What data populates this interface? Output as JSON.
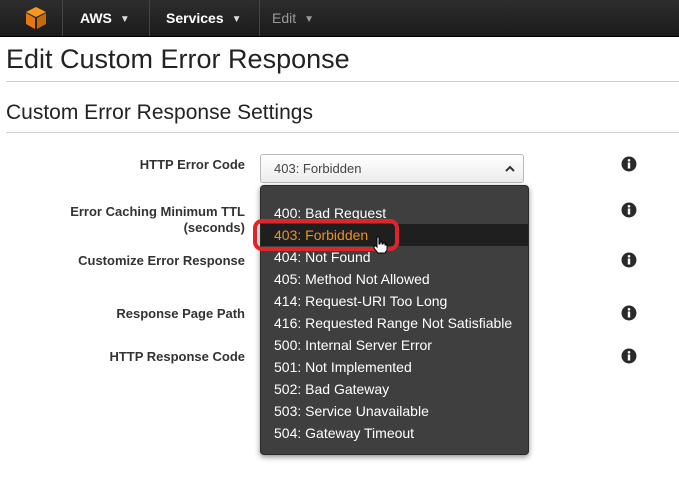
{
  "nav": {
    "logo_icon": "aws-cube-logo",
    "aws_label": "AWS",
    "services_label": "Services",
    "edit_label": "Edit",
    "caret": "▼"
  },
  "page": {
    "title": "Edit Custom Error Response",
    "section_title": "Custom Error Response Settings"
  },
  "form": {
    "http_error_code_label": "HTTP Error Code",
    "ttl_label_line1": "Error Caching Minimum TTL",
    "ttl_label_line2": "(seconds)",
    "customize_label": "Customize Error Response",
    "response_path_label": "Response Page Path",
    "response_code_label": "HTTP Response Code",
    "selected_value": "403: Forbidden",
    "info_icon": "info-icon"
  },
  "dropdown": {
    "options": [
      "400: Bad Request",
      "403: Forbidden",
      "404: Not Found",
      "405: Method Not Allowed",
      "414: Request-URI Too Long",
      "416: Requested Range Not Satisfiable",
      "500: Internal Server Error",
      "501: Not Implemented",
      "502: Bad Gateway",
      "503: Service Unavailable",
      "504: Gateway Timeout"
    ],
    "selected_index": 1
  },
  "colors": {
    "topbar": "#232323",
    "dropdown_bg": "#3f3f3f",
    "selected_text": "#e8912b",
    "highlight": "#e0242b",
    "logo": "#f7981d"
  }
}
